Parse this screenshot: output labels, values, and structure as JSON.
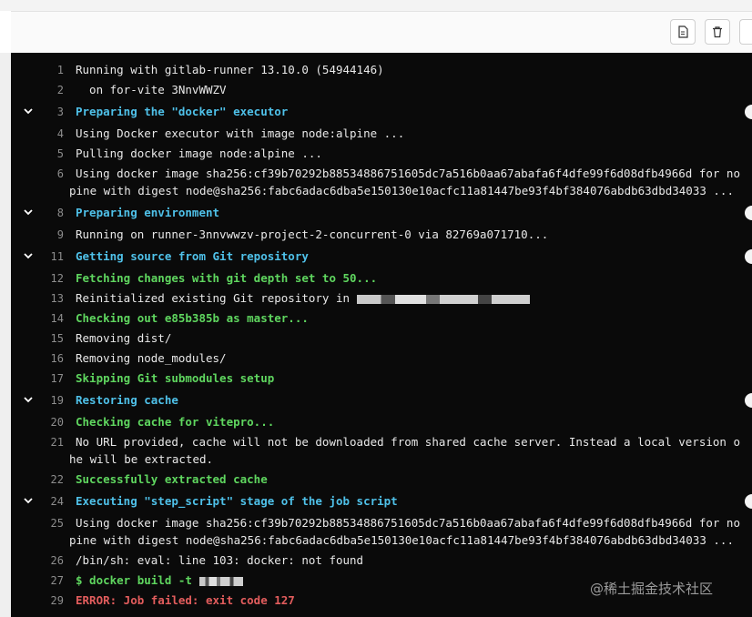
{
  "toolbar": {
    "buttons": [
      {
        "name": "raw-log-button",
        "icon": "document-icon"
      },
      {
        "name": "erase-log-button",
        "icon": "trash-icon"
      }
    ]
  },
  "log": [
    {
      "num": "1",
      "text": "Running with gitlab-runner 13.10.0 (54944146)",
      "style": "plain"
    },
    {
      "num": "2",
      "text": "  on for-vite 3NnvWWZV",
      "style": "plain"
    },
    {
      "num": "3",
      "text": "Preparing the \"docker\" executor",
      "style": "section",
      "collapsible": true
    },
    {
      "num": "4",
      "text": "Using Docker executor with image node:alpine ...",
      "style": "plain"
    },
    {
      "num": "5",
      "text": "Pulling docker image node:alpine ...",
      "style": "plain"
    },
    {
      "num": "6",
      "text": "Using docker image sha256:cf39b70292b88534886751605dc7a516b0aa67abafa6f4dfe99f6d08dfb4966d for no",
      "style": "plain",
      "cont": "pine with digest node@sha256:fabc6adac6dba5e150130e10acfc11a81447be93f4bf384076abdb63dbd34033 ..."
    },
    {
      "num": "8",
      "text": "Preparing environment",
      "style": "section",
      "collapsible": true
    },
    {
      "num": "9",
      "text": "Running on runner-3nnvwwzv-project-2-concurrent-0 via 82769a071710...",
      "style": "plain"
    },
    {
      "num": "11",
      "text": "Getting source from Git repository",
      "style": "section",
      "collapsible": true
    },
    {
      "num": "12",
      "text": "Fetching changes with git depth set to 50...",
      "style": "success"
    },
    {
      "num": "13",
      "text": "Reinitialized existing Git repository in",
      "style": "plain",
      "redacted": true
    },
    {
      "num": "14",
      "text": "Checking out e85b385b as master...",
      "style": "success"
    },
    {
      "num": "15",
      "text": "Removing dist/",
      "style": "plain"
    },
    {
      "num": "16",
      "text": "Removing node_modules/",
      "style": "plain"
    },
    {
      "num": "17",
      "text": "Skipping Git submodules setup",
      "style": "success"
    },
    {
      "num": "19",
      "text": "Restoring cache",
      "style": "section",
      "collapsible": true
    },
    {
      "num": "20",
      "text": "Checking cache for vitepro...",
      "style": "success"
    },
    {
      "num": "21",
      "text": "No URL provided, cache will not be downloaded from shared cache server. Instead a local version o",
      "style": "plain",
      "cont": "he will be extracted."
    },
    {
      "num": "22",
      "text": "Successfully extracted cache",
      "style": "success"
    },
    {
      "num": "24",
      "text": "Executing \"step_script\" stage of the job script",
      "style": "section",
      "collapsible": true
    },
    {
      "num": "25",
      "text": "Using docker image sha256:cf39b70292b88534886751605dc7a516b0aa67abafa6f4dfe99f6d08dfb4966d for no",
      "style": "plain",
      "cont": "pine with digest node@sha256:fabc6adac6dba5e150130e10acfc11a81447be93f4bf384076abdb63dbd34033 ..."
    },
    {
      "num": "26",
      "text": "/bin/sh: eval: line 103: docker: not found",
      "style": "plain"
    },
    {
      "num": "27",
      "text": "$ docker build -t",
      "style": "success",
      "redacted": true
    },
    {
      "num": "29",
      "text": "ERROR: Job failed: exit code 127",
      "style": "error"
    }
  ],
  "watermark": "@稀土掘金技术社区",
  "colors": {
    "background": "#0a0a0a",
    "section": "#4fc1e9",
    "success": "#5fd65f",
    "error": "#e35d5d",
    "text": "#e8e8e8",
    "linenum": "#8d8d8d"
  }
}
